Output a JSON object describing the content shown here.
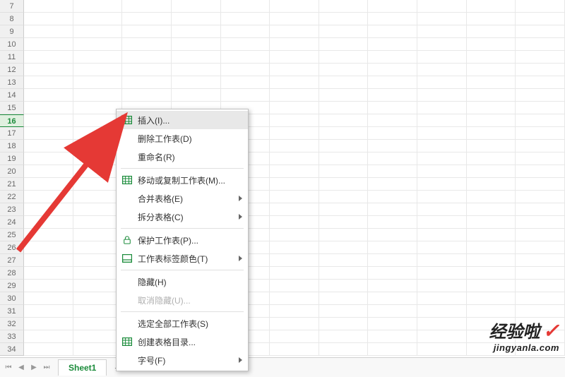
{
  "rows": [
    "7",
    "8",
    "9",
    "10",
    "11",
    "12",
    "13",
    "14",
    "15",
    "16",
    "17",
    "18",
    "19",
    "20",
    "21",
    "22",
    "23",
    "24",
    "25",
    "26",
    "27",
    "28",
    "29",
    "30",
    "31",
    "32",
    "33",
    "34"
  ],
  "active_row_index": 9,
  "menu": {
    "items": [
      {
        "label": "插入(I)...",
        "icon": "table-icon",
        "hovered": true
      },
      {
        "label": "删除工作表(D)",
        "icon": ""
      },
      {
        "label": "重命名(R)",
        "icon": ""
      },
      {
        "divider": true
      },
      {
        "label": "移动或复制工作表(M)...",
        "icon": "table-icon"
      },
      {
        "label": "合并表格(E)",
        "icon": "",
        "submenu": true
      },
      {
        "label": "拆分表格(C)",
        "icon": "",
        "submenu": true
      },
      {
        "divider": true
      },
      {
        "label": "保护工作表(P)...",
        "icon": "lock-icon"
      },
      {
        "label": "工作表标签颜色(T)",
        "icon": "color-icon",
        "submenu": true
      },
      {
        "divider": true
      },
      {
        "label": "隐藏(H)",
        "icon": ""
      },
      {
        "label": "取消隐藏(U)...",
        "icon": "",
        "disabled": true
      },
      {
        "divider": true
      },
      {
        "label": "选定全部工作表(S)",
        "icon": ""
      },
      {
        "label": "创建表格目录...",
        "icon": "table-icon"
      },
      {
        "label": "字号(F)",
        "icon": "",
        "submenu": true
      }
    ]
  },
  "tabs": {
    "sheet_label": "Sheet1"
  },
  "watermark": {
    "cn": "经验啦",
    "url": "jingyanla.com"
  }
}
